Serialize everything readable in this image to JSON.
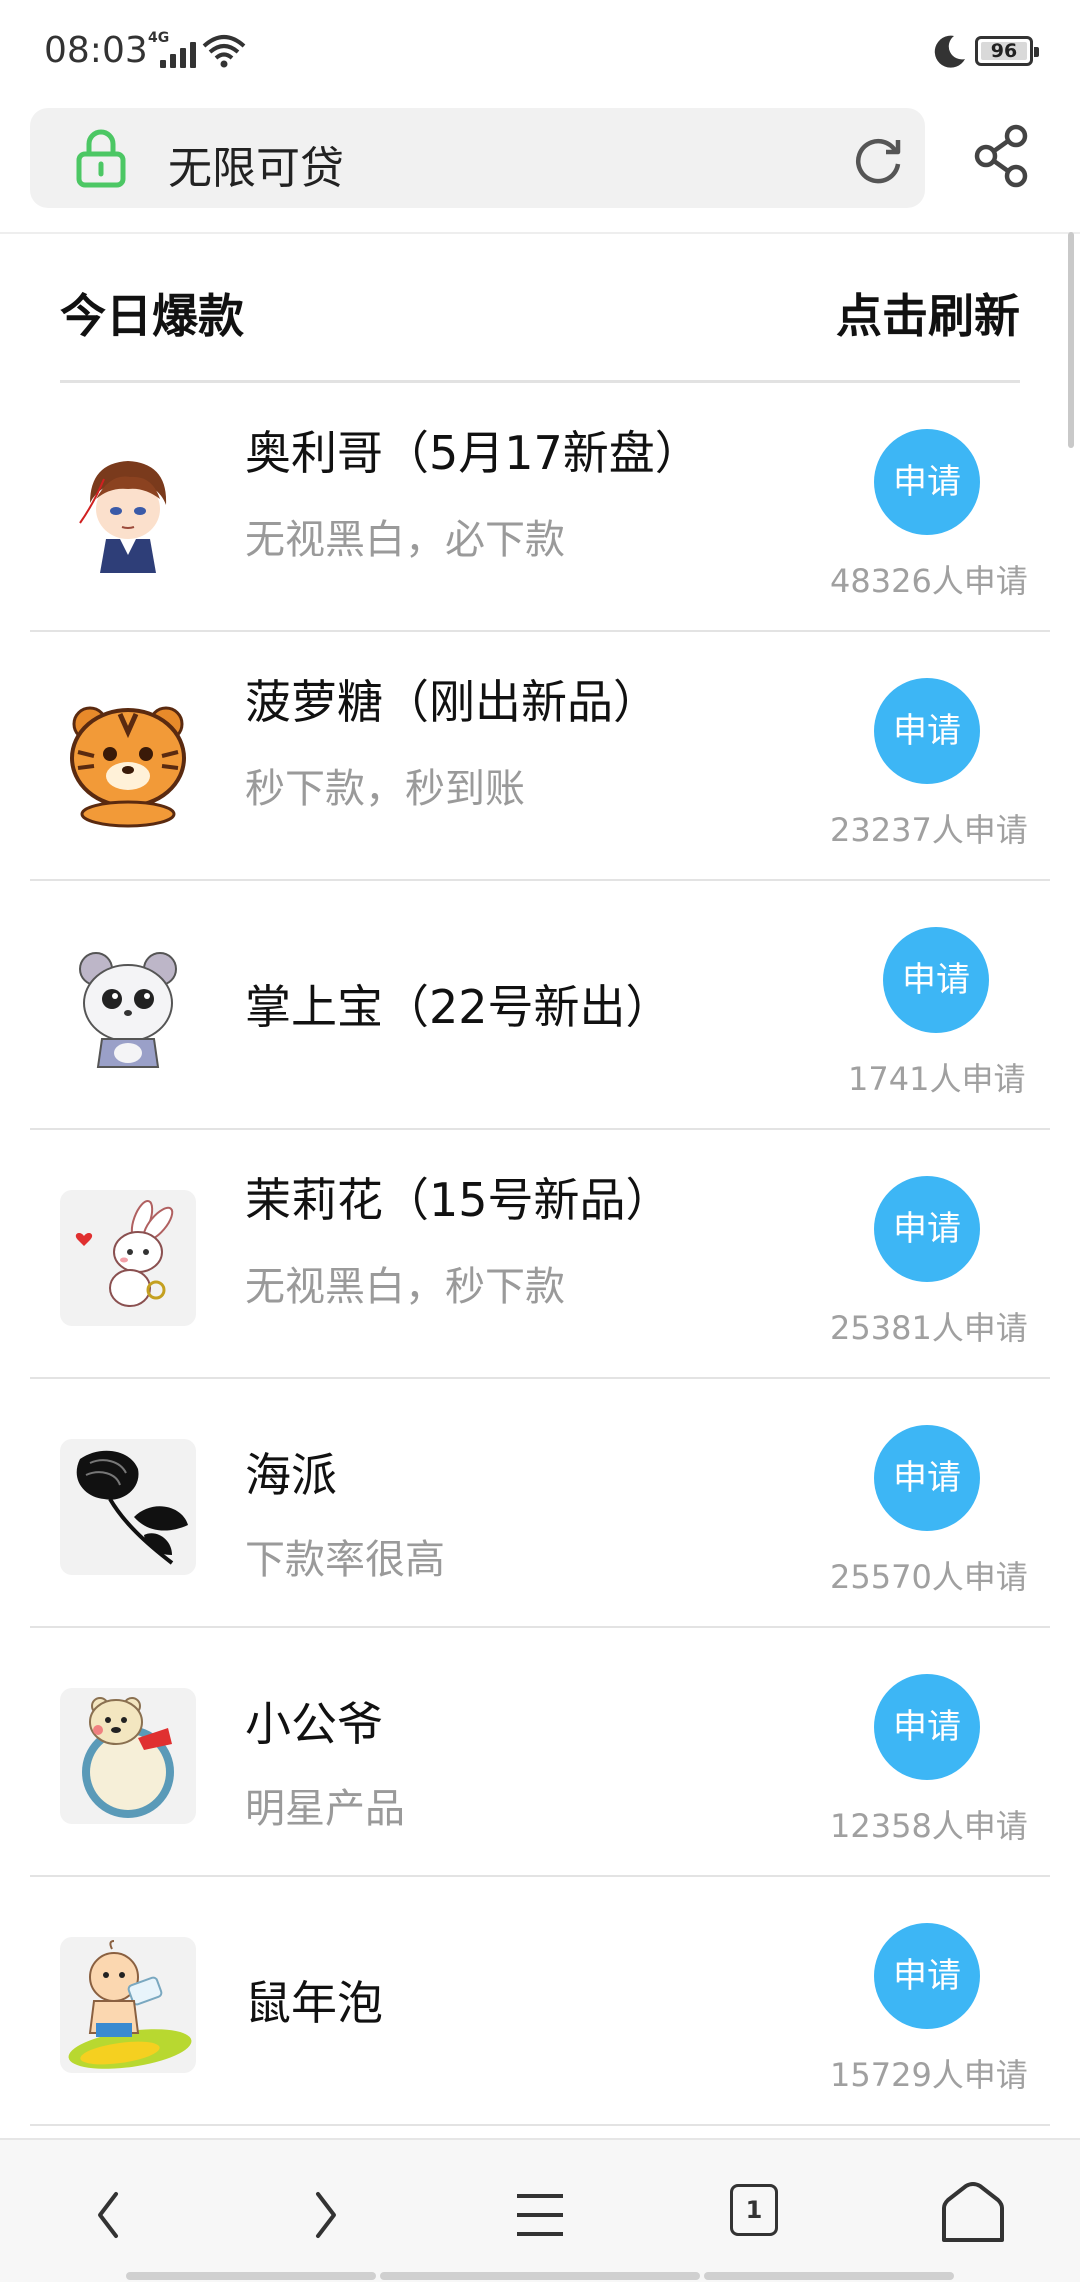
{
  "status_bar": {
    "time": "08:03",
    "network": "4G",
    "battery": "96"
  },
  "address_bar": {
    "title": "无限可贷"
  },
  "list_header": {
    "title": "今日爆款",
    "refresh": "点击刷新"
  },
  "items": [
    {
      "title": "奥利哥（5月17新盘）",
      "subtitle": "无视黑白，必下款",
      "button": "申请",
      "count": "48326人申请",
      "icon": "anime-boy-avatar"
    },
    {
      "title": "菠萝糖（刚出新品）",
      "subtitle": "秒下款，秒到账",
      "button": "申请",
      "count": "23237人申请",
      "icon": "tiger-avatar"
    },
    {
      "title": "掌上宝（22号新出）",
      "subtitle": "",
      "button": "申请",
      "count": "1741人申请",
      "icon": "hamster-avatar"
    },
    {
      "title": "茉莉花（15号新品）",
      "subtitle": "无视黑白，秒下款",
      "button": "申请",
      "count": "25381人申请",
      "icon": "bunny-avatar"
    },
    {
      "title": "海派",
      "subtitle": "下款率很高",
      "button": "申请",
      "count": "25570人申请",
      "icon": "rose-avatar"
    },
    {
      "title": "小公爷",
      "subtitle": "明星产品",
      "button": "申请",
      "count": "12358人申请",
      "icon": "bear-avatar"
    },
    {
      "title": "鼠年泡",
      "subtitle": "",
      "button": "申请",
      "count": "15729人申请",
      "icon": "baby-avatar"
    }
  ],
  "bottom_nav": {
    "tab_count": "1"
  },
  "colors": {
    "accent": "#3db6f5",
    "lock": "#4cc764"
  }
}
